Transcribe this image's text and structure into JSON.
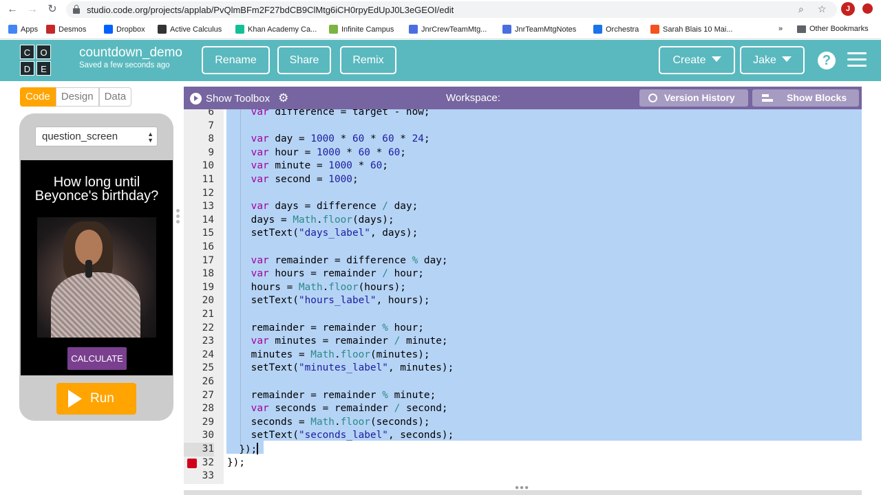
{
  "browser": {
    "url": "studio.code.org/projects/applab/PvQlmBFm2F27bdCB9ClMtg6iCH0rpyEdUpJ0L3eGEOI/edit",
    "profile_initial": "J",
    "bookmarks": [
      {
        "label": "Apps",
        "color": "#4285f4"
      },
      {
        "label": "Desmos",
        "color": "#c62828"
      },
      {
        "label": "Dropbox",
        "color": "#0061ff"
      },
      {
        "label": "Active Calculus",
        "color": "#333333"
      },
      {
        "label": "Khan Academy Ca...",
        "color": "#14bf96"
      },
      {
        "label": "Infinite Campus",
        "color": "#7cb342"
      },
      {
        "label": "JnrCrewTeamMtg...",
        "color": "#4a6ee0"
      },
      {
        "label": "JnrTeamMtgNotes",
        "color": "#4a6ee0"
      },
      {
        "label": "Orchestra",
        "color": "#1a73e8"
      },
      {
        "label": "Sarah Blais 10 Mai...",
        "color": "#f4511e"
      }
    ],
    "more_bookmarks": "»",
    "other_bookmarks": "Other Bookmarks"
  },
  "header": {
    "logo_letters": [
      "C",
      "O",
      "D",
      "E"
    ],
    "project_name": "countdown_demo",
    "saved_status": "Saved a few seconds ago",
    "rename_label": "Rename",
    "share_label": "Share",
    "remix_label": "Remix",
    "create_label": "Create",
    "user_label": "Jake",
    "help_label": "?"
  },
  "left": {
    "tabs": [
      "Code",
      "Design",
      "Data"
    ],
    "screen_select": "question_screen",
    "app_title": "How long until Beyonce's birthday?",
    "calc_label": "CALCULATE",
    "run_label": "Run"
  },
  "workspace": {
    "show_toolbox": "Show Toolbox",
    "title": "Workspace:",
    "version_history": "Version History",
    "show_blocks": "Show Blocks"
  },
  "code_lines": [
    {
      "n": "6",
      "t": "    var difference = target - now;"
    },
    {
      "n": "7",
      "t": ""
    },
    {
      "n": "8",
      "t": "    var day = 1000 * 60 * 60 * 24;"
    },
    {
      "n": "9",
      "t": "    var hour = 1000 * 60 * 60;"
    },
    {
      "n": "10",
      "t": "    var minute = 1000 * 60;"
    },
    {
      "n": "11",
      "t": "    var second = 1000;"
    },
    {
      "n": "12",
      "t": ""
    },
    {
      "n": "13",
      "t": "    var days = difference / day;"
    },
    {
      "n": "14",
      "t": "    days = Math.floor(days);"
    },
    {
      "n": "15",
      "t": "    setText(\"days_label\", days);"
    },
    {
      "n": "16",
      "t": ""
    },
    {
      "n": "17",
      "t": "    var remainder = difference % day;"
    },
    {
      "n": "18",
      "t": "    var hours = remainder / hour;"
    },
    {
      "n": "19",
      "t": "    hours = Math.floor(hours);"
    },
    {
      "n": "20",
      "t": "    setText(\"hours_label\", hours);"
    },
    {
      "n": "21",
      "t": ""
    },
    {
      "n": "22",
      "t": "    remainder = remainder % hour;"
    },
    {
      "n": "23",
      "t": "    var minutes = remainder / minute;"
    },
    {
      "n": "24",
      "t": "    minutes = Math.floor(minutes);"
    },
    {
      "n": "25",
      "t": "    setText(\"minutes_label\", minutes);"
    },
    {
      "n": "26",
      "t": ""
    },
    {
      "n": "27",
      "t": "    remainder = remainder % minute;"
    },
    {
      "n": "28",
      "t": "    var seconds = remainder / second;"
    },
    {
      "n": "29",
      "t": "    seconds = Math.floor(seconds);"
    },
    {
      "n": "30",
      "t": "    setText(\"seconds_label\", seconds);"
    },
    {
      "n": "31",
      "t": "  });"
    },
    {
      "n": "32",
      "t": "});"
    },
    {
      "n": "33",
      "t": ""
    }
  ],
  "breakpoint_line": "32",
  "cursor_line": "31",
  "colors": {
    "header": "#59b9be",
    "workspace_header": "#7665a0",
    "run_button": "#ffa400",
    "calculate_button": "#7a3f8f",
    "selection": "#b5d3f5"
  }
}
